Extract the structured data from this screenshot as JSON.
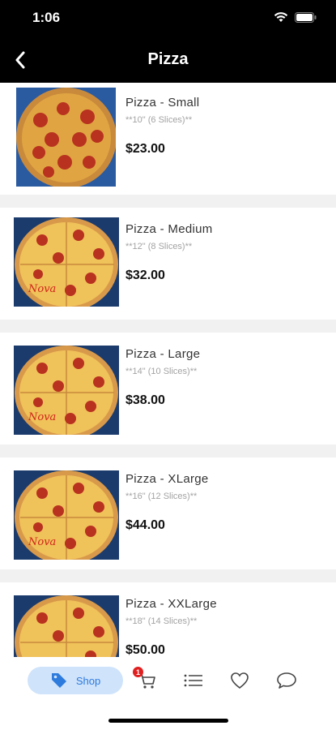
{
  "status": {
    "time": "1:06"
  },
  "nav": {
    "title": "Pizza"
  },
  "products": [
    {
      "name": "Pizza - Small",
      "desc": "**10\" (6 Slices)**",
      "price": "$23.00"
    },
    {
      "name": "Pizza - Medium",
      "desc": "**12\" (8 Slices)**",
      "price": "$32.00"
    },
    {
      "name": "Pizza - Large",
      "desc": "**14\" (10 Slices)**",
      "price": "$38.00"
    },
    {
      "name": "Pizza - XLarge",
      "desc": "**16\" (12 Slices)**",
      "price": "$44.00"
    },
    {
      "name": "Pizza - XXLarge",
      "desc": "**18\" (14 Slices)**",
      "price": "$50.00"
    }
  ],
  "tabbar": {
    "shop_label": "Shop",
    "cart_badge": "1",
    "tabs": [
      "tag-icon",
      "cart-icon",
      "list-icon",
      "heart-icon",
      "chat-icon"
    ]
  },
  "colors": {
    "accent": "#2d7bdc",
    "accent_bg": "#cfe3fb",
    "badge": "#e02020",
    "header": "#000000"
  }
}
